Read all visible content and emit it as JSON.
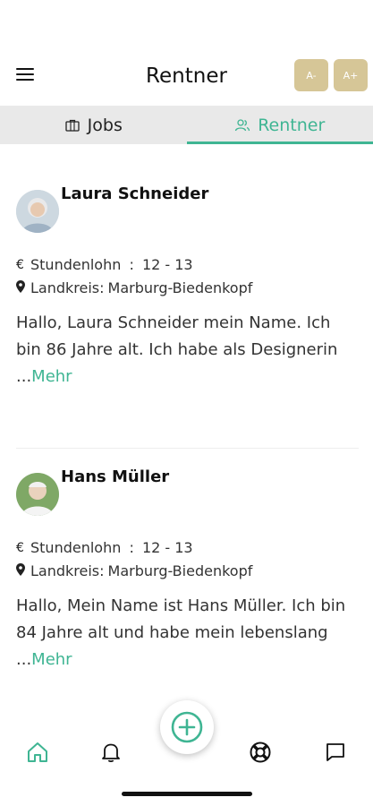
{
  "header": {
    "title": "Rentner",
    "font_decrease_label": "A-",
    "font_increase_label": "A+"
  },
  "tabs": [
    {
      "label": "Jobs",
      "active": false
    },
    {
      "label": "Rentner",
      "active": true
    }
  ],
  "entries": [
    {
      "name": "Laura Schneider",
      "wage_label": "Stundenlohn",
      "wage_sep": " : ",
      "wage_value": "12 - 13",
      "district_label": "Landkreis:",
      "district_value": "Marburg-Biedenkopf",
      "description": "Hallo, Laura Schneider mein Name. Ich bin 86 Jahre alt. Ich habe als Designerin ...",
      "more_label": "Mehr"
    },
    {
      "name": "Hans Müller",
      "wage_label": "Stundenlohn",
      "wage_sep": " : ",
      "wage_value": "12 - 13",
      "district_label": "Landkreis:",
      "district_value": "Marburg-Biedenkopf",
      "description": "Hallo, Mein Name ist Hans Müller. Ich bin 84 Jahre alt und habe mein lebenslang ...",
      "more_label": "Mehr"
    }
  ],
  "icons": {
    "wage": "€",
    "district": "location-pin-icon"
  },
  "colors": {
    "accent": "#3fb593",
    "font_button": "#d6c697",
    "tab_bar": "#e9e9e9"
  }
}
